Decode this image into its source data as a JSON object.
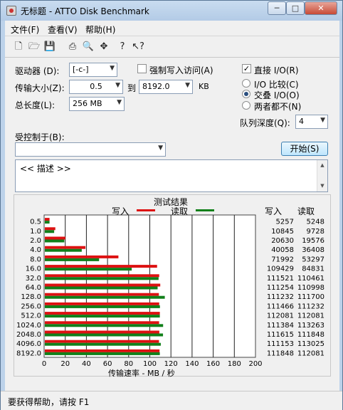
{
  "window": {
    "title": "无标题 - ATTO Disk Benchmark",
    "min": "─",
    "max": "□",
    "close": "✕"
  },
  "menu": [
    "文件(F)",
    "查看(V)",
    "帮助(H)"
  ],
  "toolbar_icons": [
    "new-icon",
    "open-icon",
    "save-icon",
    "print-icon",
    "print-preview-icon",
    "move-icon",
    "help-icon",
    "context-help-icon"
  ],
  "form": {
    "drive_label": "驱动器 (D):",
    "drive_value": "[-c-]",
    "force_write_label": "强制写入访问(A)",
    "force_write_checked": false,
    "direct_io_label": "直接 I/O(R)",
    "direct_io_checked": true,
    "transfer_label": "传输大小(Z):",
    "transfer_from": "0.5",
    "to_label": "到",
    "transfer_to": "8192.0",
    "kb_label": "KB",
    "io_compare_label": "I/O 比较(C)",
    "overlap_io_label": "交叠 I/O(O)",
    "neither_label": "两者都不(N)",
    "selected_mode": "overlap",
    "length_label": "总长度(L):",
    "length_value": "256 MB",
    "queue_label": "队列深度(Q):",
    "queue_value": "4",
    "controlled_label": "受控制于(B):",
    "controlled_value": "",
    "start_button": "开始(S)",
    "description": "<< 描述 >>"
  },
  "results": {
    "title": "测试结果",
    "write_legend": "写入",
    "read_legend": "读取",
    "write_header": "写入",
    "read_header": "读取",
    "xlabel": "传输速率 - MB / 秒",
    "write_color": "#dd1111",
    "read_color": "#11801a"
  },
  "chart_data": {
    "type": "bar",
    "title": "测试结果",
    "xlabel": "传输速率 - MB / 秒",
    "xlim": [
      0,
      200
    ],
    "xticks": [
      "0",
      "20",
      "40",
      "60",
      "80",
      "100",
      "120",
      "140",
      "160",
      "180",
      "200"
    ],
    "categories": [
      "0.5",
      "1.0",
      "2.0",
      "4.0",
      "8.0",
      "16.0",
      "32.0",
      "64.0",
      "128.0",
      "256.0",
      "512.0",
      "1024.0",
      "2048.0",
      "4096.0",
      "8192.0"
    ],
    "series": [
      {
        "name": "写入",
        "values": [
          5.1,
          10.6,
          20.1,
          39.1,
          70.3,
          106.9,
          108.9,
          109.9,
          108.6,
          108.9,
          109.5,
          108.8,
          109.0,
          108.7,
          109.2
        ]
      },
      {
        "name": "读取",
        "values": [
          5.1,
          9.5,
          19.1,
          35.6,
          52.0,
          82.9,
          108.3,
          107.4,
          114.2,
          109.6,
          109.5,
          112.6,
          112.5,
          110.4,
          109.5
        ]
      }
    ],
    "table_write": [
      "5257",
      "10845",
      "20630",
      "40058",
      "71992",
      "109429",
      "111521",
      "111254",
      "111232",
      "111466",
      "112081",
      "111384",
      "111615",
      "111153",
      "111848"
    ],
    "table_read": [
      "5248",
      "9728",
      "19576",
      "36408",
      "53297",
      "84831",
      "110461",
      "110998",
      "111700",
      "111232",
      "112081",
      "113263",
      "111848",
      "113025",
      "112081"
    ]
  },
  "status": "要获得帮助，请按 F1"
}
